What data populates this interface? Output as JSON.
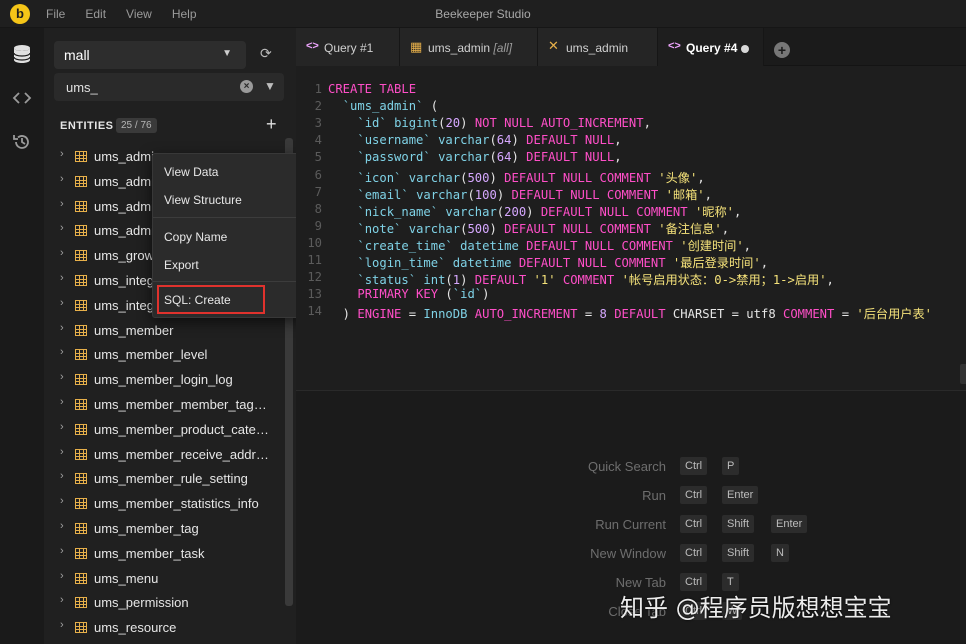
{
  "app": {
    "title": "Beekeeper Studio",
    "logo": "b"
  },
  "menubar": [
    "File",
    "Edit",
    "View",
    "Help"
  ],
  "sidebar": {
    "connection": "mall",
    "filter_value": "ums_",
    "entities_label": "ENTITIES",
    "entities_count": "25 / 76",
    "tables": [
      "ums_admin",
      "ums_admin_login_log",
      "ums_admin_permission_relation",
      "ums_admin_role_relation",
      "ums_growth_change_history",
      "ums_integration_change_history",
      "ums_integration_consume_setting",
      "ums_member",
      "ums_member_level",
      "ums_member_login_log",
      "ums_member_member_tag_relation",
      "ums_member_product_category_relation",
      "ums_member_receive_address",
      "ums_member_rule_setting",
      "ums_member_statistics_info",
      "ums_member_tag",
      "ums_member_task",
      "ums_menu",
      "ums_permission",
      "ums_resource"
    ]
  },
  "context_menu": [
    "View Data",
    "View Structure",
    "Copy Name",
    "Export",
    "SQL: Create"
  ],
  "tabs": [
    {
      "label": "Query #1",
      "suffix": "",
      "icon": "code-icon",
      "active": false
    },
    {
      "label": "ums_admin",
      "suffix": "[all]",
      "icon": "table-icon",
      "active": false
    },
    {
      "label": "ums_admin",
      "suffix": "",
      "icon": "tools-icon",
      "active": false
    },
    {
      "label": "Query #4",
      "suffix": "",
      "icon": "code-icon",
      "active": true
    }
  ],
  "code_lines": [
    [
      [
        "kw",
        "CREATE TABLE"
      ]
    ],
    [
      [
        "pl",
        "  "
      ],
      [
        "id",
        "`ums_admin`"
      ],
      [
        "pl",
        " ("
      ]
    ],
    [
      [
        "pl",
        "    "
      ],
      [
        "id",
        "`id`"
      ],
      [
        "pl",
        " "
      ],
      [
        "id",
        "bigint"
      ],
      [
        "pl",
        "("
      ],
      [
        "nu",
        "20"
      ],
      [
        "pl",
        ") "
      ],
      [
        "kw",
        "NOT NULL AUTO_INCREMENT"
      ],
      [
        "pl",
        ","
      ]
    ],
    [
      [
        "pl",
        "    "
      ],
      [
        "id",
        "`username`"
      ],
      [
        "pl",
        " "
      ],
      [
        "id",
        "varchar"
      ],
      [
        "pl",
        "("
      ],
      [
        "nu",
        "64"
      ],
      [
        "pl",
        ") "
      ],
      [
        "kw",
        "DEFAULT NULL"
      ],
      [
        "pl",
        ","
      ]
    ],
    [
      [
        "pl",
        "    "
      ],
      [
        "id",
        "`password`"
      ],
      [
        "pl",
        " "
      ],
      [
        "id",
        "varchar"
      ],
      [
        "pl",
        "("
      ],
      [
        "nu",
        "64"
      ],
      [
        "pl",
        ") "
      ],
      [
        "kw",
        "DEFAULT NULL"
      ],
      [
        "pl",
        ","
      ]
    ],
    [
      [
        "pl",
        "    "
      ],
      [
        "id",
        "`icon`"
      ],
      [
        "pl",
        " "
      ],
      [
        "id",
        "varchar"
      ],
      [
        "pl",
        "("
      ],
      [
        "nu",
        "500"
      ],
      [
        "pl",
        ") "
      ],
      [
        "kw",
        "DEFAULT NULL COMMENT"
      ],
      [
        "pl",
        " "
      ],
      [
        "st",
        "'头像'"
      ],
      [
        "pl",
        ","
      ]
    ],
    [
      [
        "pl",
        "    "
      ],
      [
        "id",
        "`email`"
      ],
      [
        "pl",
        " "
      ],
      [
        "id",
        "varchar"
      ],
      [
        "pl",
        "("
      ],
      [
        "nu",
        "100"
      ],
      [
        "pl",
        ") "
      ],
      [
        "kw",
        "DEFAULT NULL COMMENT"
      ],
      [
        "pl",
        " "
      ],
      [
        "st",
        "'邮箱'"
      ],
      [
        "pl",
        ","
      ]
    ],
    [
      [
        "pl",
        "    "
      ],
      [
        "id",
        "`nick_name`"
      ],
      [
        "pl",
        " "
      ],
      [
        "id",
        "varchar"
      ],
      [
        "pl",
        "("
      ],
      [
        "nu",
        "200"
      ],
      [
        "pl",
        ") "
      ],
      [
        "kw",
        "DEFAULT NULL COMMENT"
      ],
      [
        "pl",
        " "
      ],
      [
        "st",
        "'昵称'"
      ],
      [
        "pl",
        ","
      ]
    ],
    [
      [
        "pl",
        "    "
      ],
      [
        "id",
        "`note`"
      ],
      [
        "pl",
        " "
      ],
      [
        "id",
        "varchar"
      ],
      [
        "pl",
        "("
      ],
      [
        "nu",
        "500"
      ],
      [
        "pl",
        ") "
      ],
      [
        "kw",
        "DEFAULT NULL COMMENT"
      ],
      [
        "pl",
        " "
      ],
      [
        "st",
        "'备注信息'"
      ],
      [
        "pl",
        ","
      ]
    ],
    [
      [
        "pl",
        "    "
      ],
      [
        "id",
        "`create_time`"
      ],
      [
        "pl",
        " "
      ],
      [
        "id",
        "datetime"
      ],
      [
        "pl",
        " "
      ],
      [
        "kw",
        "DEFAULT NULL COMMENT"
      ],
      [
        "pl",
        " "
      ],
      [
        "st",
        "'创建时间'"
      ],
      [
        "pl",
        ","
      ]
    ],
    [
      [
        "pl",
        "    "
      ],
      [
        "id",
        "`login_time`"
      ],
      [
        "pl",
        " "
      ],
      [
        "id",
        "datetime"
      ],
      [
        "pl",
        " "
      ],
      [
        "kw",
        "DEFAULT NULL COMMENT"
      ],
      [
        "pl",
        " "
      ],
      [
        "st",
        "'最后登录时间'"
      ],
      [
        "pl",
        ","
      ]
    ],
    [
      [
        "pl",
        "    "
      ],
      [
        "id",
        "`status`"
      ],
      [
        "pl",
        " "
      ],
      [
        "id",
        "int"
      ],
      [
        "pl",
        "("
      ],
      [
        "nu",
        "1"
      ],
      [
        "pl",
        ") "
      ],
      [
        "kw",
        "DEFAULT"
      ],
      [
        "pl",
        " "
      ],
      [
        "st",
        "'1'"
      ],
      [
        "pl",
        " "
      ],
      [
        "kw",
        "COMMENT"
      ],
      [
        "pl",
        " "
      ],
      [
        "st",
        "'帐号启用状态：0->禁用；1->启用'"
      ],
      [
        "pl",
        ","
      ]
    ],
    [
      [
        "pl",
        "    "
      ],
      [
        "kw",
        "PRIMARY KEY"
      ],
      [
        "pl",
        " ("
      ],
      [
        "id",
        "`id`"
      ],
      [
        "pl",
        ")"
      ]
    ],
    [
      [
        "pl",
        "  ) "
      ],
      [
        "kw",
        "ENGINE"
      ],
      [
        "pl",
        " = "
      ],
      [
        "id",
        "InnoDB"
      ],
      [
        "pl",
        " "
      ],
      [
        "kw",
        "AUTO_INCREMENT"
      ],
      [
        "pl",
        " = "
      ],
      [
        "nu",
        "8"
      ],
      [
        "pl",
        " "
      ],
      [
        "kw",
        "DEFAULT"
      ],
      [
        "pl",
        " CHARSET = utf8 "
      ],
      [
        "kw",
        "COMMENT"
      ],
      [
        "pl",
        " = "
      ],
      [
        "st",
        "'后台用户表'"
      ]
    ]
  ],
  "shortcuts": [
    {
      "label": "Quick Search",
      "keys": [
        "Ctrl",
        "P"
      ]
    },
    {
      "label": "Run",
      "keys": [
        "Ctrl",
        "Enter"
      ]
    },
    {
      "label": "Run Current",
      "keys": [
        "Ctrl",
        "Shift",
        "Enter"
      ]
    },
    {
      "label": "New Window",
      "keys": [
        "Ctrl",
        "Shift",
        "N"
      ]
    },
    {
      "label": "New Tab",
      "keys": [
        "Ctrl",
        "T"
      ]
    },
    {
      "label": "Close Tab",
      "keys": [
        "Ctrl",
        "W"
      ]
    }
  ],
  "watermark": "知乎 @程序员版想想宝宝"
}
